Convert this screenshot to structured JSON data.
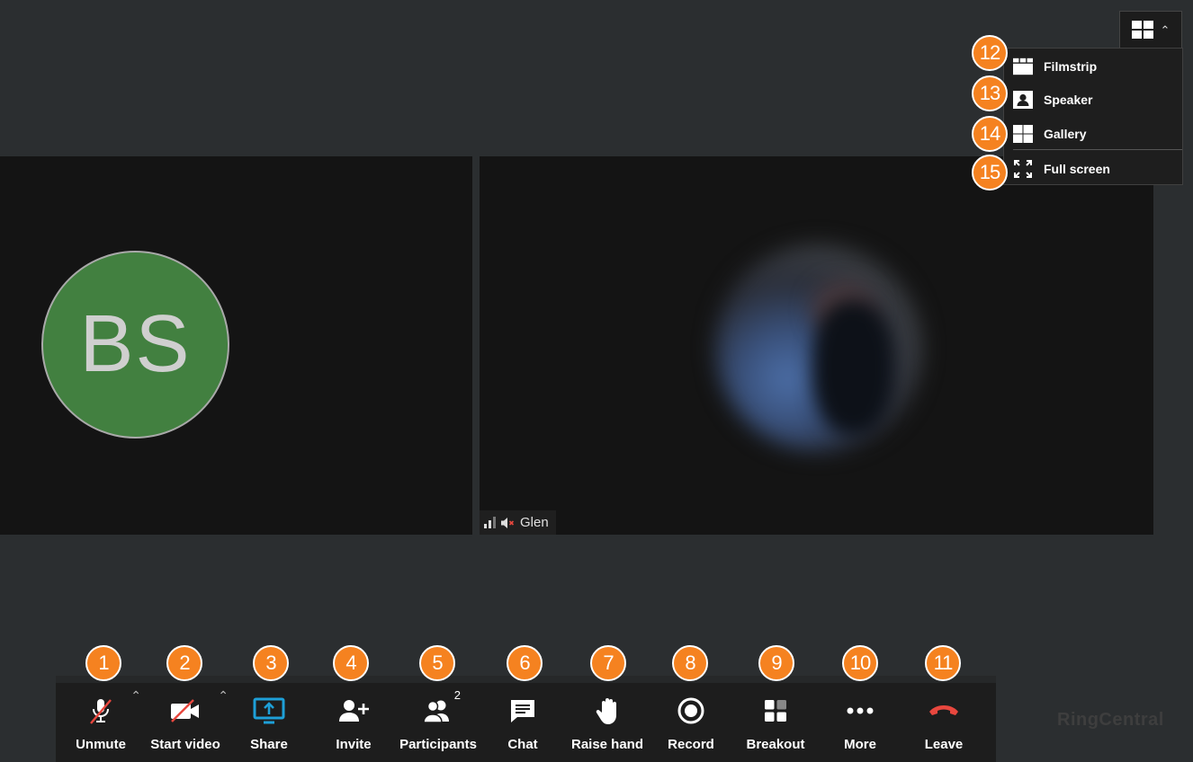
{
  "participants": {
    "bs": {
      "initials": "BS",
      "avatar_color": "#428040"
    },
    "glen": {
      "name": "Glen"
    }
  },
  "layout_menu": {
    "items": [
      {
        "label": "Filmstrip",
        "badge": "12"
      },
      {
        "label": "Speaker",
        "badge": "13"
      },
      {
        "label": "Gallery",
        "badge": "14"
      },
      {
        "label": "Full screen",
        "badge": "15"
      }
    ]
  },
  "toolbar": {
    "items": [
      {
        "label": "Unmute",
        "badge": "1"
      },
      {
        "label": "Start video",
        "badge": "2"
      },
      {
        "label": "Share",
        "badge": "3"
      },
      {
        "label": "Invite",
        "badge": "4"
      },
      {
        "label": "Participants",
        "badge": "5",
        "count": "2"
      },
      {
        "label": "Chat",
        "badge": "6"
      },
      {
        "label": "Raise hand",
        "badge": "7"
      },
      {
        "label": "Record",
        "badge": "8"
      },
      {
        "label": "Breakout",
        "badge": "9"
      },
      {
        "label": "More",
        "badge": "10"
      },
      {
        "label": "Leave",
        "badge": "11"
      }
    ]
  },
  "brand": "RingCentral",
  "colors": {
    "badge": "#f58220",
    "share": "#1ea0d8",
    "leave": "#e8473e",
    "muted_slash": "#e8473e"
  }
}
